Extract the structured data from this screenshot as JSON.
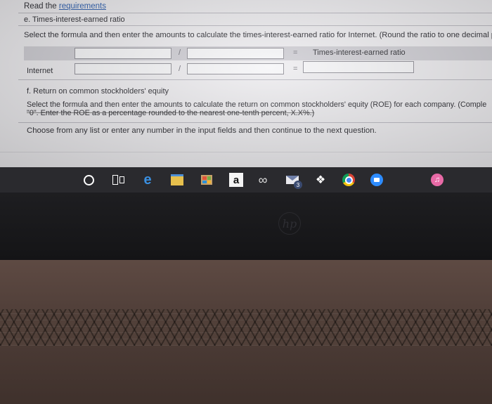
{
  "header": {
    "read_prefix": "Read the ",
    "read_link": "requirements"
  },
  "section_e": {
    "title": "e. Times-interest-earned ratio",
    "instruction": "Select the formula and then enter the amounts to calculate the times-interest-earned ratio for Internet. (Round the ratio to one decimal pl",
    "slash": "/",
    "equals": "=",
    "result_header": "Times-interest-earned ratio",
    "row_label": "Internet"
  },
  "section_f": {
    "title": "f. Return on common stockholders' equity",
    "instruction_line1": "Select the formula and then enter the amounts to calculate the return on common stockholders' equity (ROE) for each company. (Comple",
    "instruction_line2": "\"0\". Enter the ROE as a percentage rounded to the nearest one-tenth percent, X.X%.)"
  },
  "footer": {
    "text": "Choose from any list or enter any number in the input fields and then continue to the next question."
  },
  "taskbar": {
    "icons": [
      "cortana-circle-icon",
      "task-view-icon",
      "edge-icon",
      "file-explorer-icon",
      "store-icon",
      "amazon-icon",
      "infinity-icon",
      "mail-icon",
      "dropbox-icon",
      "chrome-icon",
      "zoom-icon",
      "itunes-icon"
    ],
    "amazon_glyph": "a",
    "mail_badge": "3"
  },
  "colors": {
    "screen_bg": "#eeedf0",
    "link": "#2d5fb0",
    "taskbar": "#2a2a2e",
    "laptop_deck": "#4f3e38"
  }
}
